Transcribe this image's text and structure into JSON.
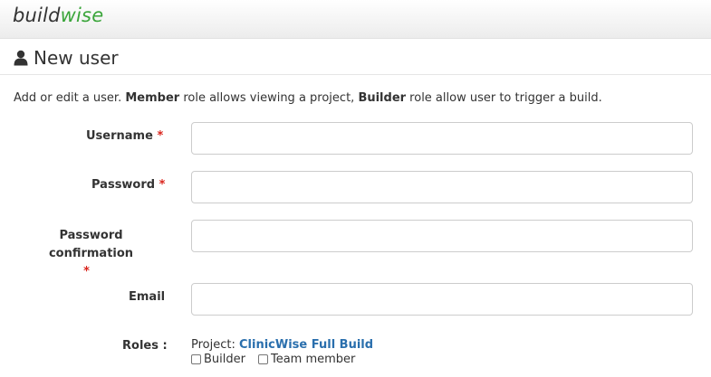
{
  "brand": {
    "part1": "build",
    "part2": "wise",
    "accent_color": "#3aa53a"
  },
  "header": {
    "icon": "user-icon",
    "title": "New user"
  },
  "intro": {
    "text1": "Add or edit a user. ",
    "bold1": "Member",
    "text2": " role allows viewing a project, ",
    "bold2": "Builder",
    "text3": " role allow user to trigger a build."
  },
  "form": {
    "required_mark": "*",
    "username": {
      "label": "Username",
      "value": ""
    },
    "password": {
      "label": "Password",
      "value": ""
    },
    "password_confirmation": {
      "label": "Password confirmation",
      "value": ""
    },
    "email": {
      "label": "Email",
      "value": ""
    },
    "roles": {
      "label": "Roles :",
      "project_prefix": "Project: ",
      "project_name": "ClinicWise Full Build",
      "options": [
        {
          "label": "Builder",
          "checked": false
        },
        {
          "label": "Team member",
          "checked": false
        }
      ]
    }
  }
}
